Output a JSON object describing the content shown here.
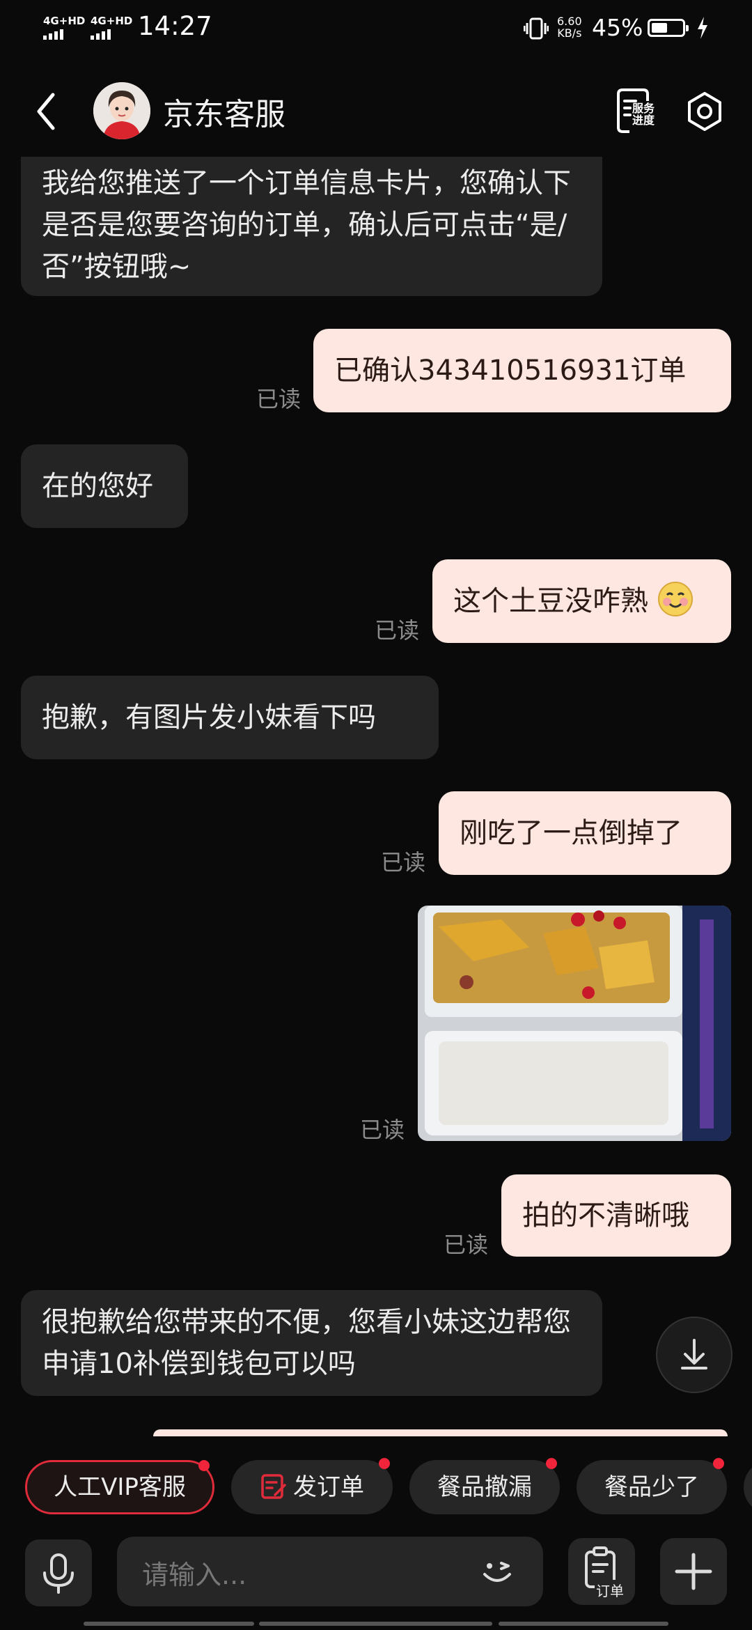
{
  "status_bar": {
    "sim1": "4G+HD",
    "sim2": "4G+HD",
    "time": "14:27",
    "speed_value": "6.60",
    "speed_unit": "KB/s",
    "battery": "45%"
  },
  "header": {
    "title": "京东客服",
    "service_progress_label": "服务进度"
  },
  "messages": [
    {
      "side": "left",
      "text": "我给您推送了一个订单信息卡片，您确认下是否是您要咨询的订单，确认后可点击“是/否”按钮哦~"
    },
    {
      "side": "right",
      "text": "已确认343410516931订单",
      "status": "已读"
    },
    {
      "side": "left",
      "text": "在的您好"
    },
    {
      "side": "right",
      "text": "这个土豆没咋熟",
      "emoji": "smiling-face",
      "status": "已读"
    },
    {
      "side": "left",
      "text": "抱歉，有图片发小妹看下吗"
    },
    {
      "side": "right",
      "text": "刚吃了一点倒掉了",
      "status": "已读"
    },
    {
      "side": "right",
      "type": "image",
      "status": "已读"
    },
    {
      "side": "right",
      "text": "拍的不清晰哦",
      "status": "已读"
    },
    {
      "side": "left",
      "text": "很抱歉给您带来的不便，您看小妹这边帮您申请10补偿到钱包可以吗"
    }
  ],
  "quick_replies": [
    {
      "label": "人工VIP客服",
      "dot": true
    },
    {
      "label": "发订单",
      "dot": true,
      "icon": "edit-order-icon"
    },
    {
      "label": "餐品撤漏",
      "dot": true
    },
    {
      "label": "餐品少了",
      "dot": true
    }
  ],
  "input": {
    "placeholder": "请输入...",
    "order_button_label": "订单"
  },
  "colors": {
    "background": "#0a0a0a",
    "left_bubble": "#242424",
    "right_bubble": "#fde7e0",
    "accent_red": "#e02b3a"
  }
}
